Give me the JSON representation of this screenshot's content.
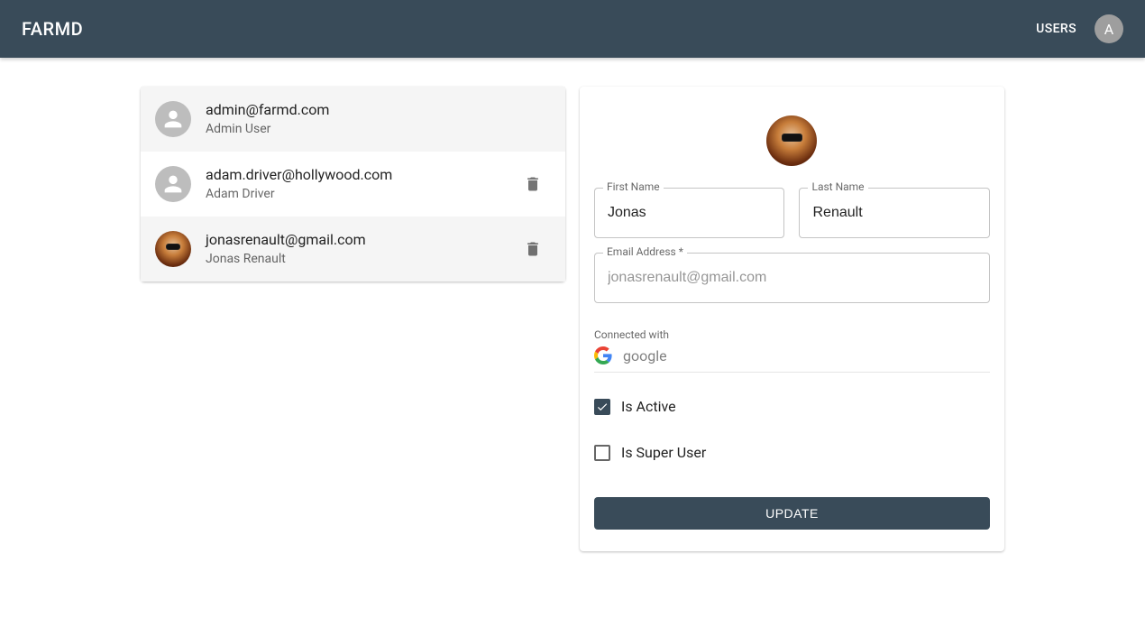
{
  "appbar": {
    "title": "FARMD",
    "nav_users": "USERS",
    "avatar_initial": "A"
  },
  "user_list": [
    {
      "email": "admin@farmd.com",
      "name": "Admin User",
      "has_photo": false,
      "deletable": false
    },
    {
      "email": "adam.driver@hollywood.com",
      "name": "Adam Driver",
      "has_photo": false,
      "deletable": true
    },
    {
      "email": "jonasrenault@gmail.com",
      "name": "Jonas Renault",
      "has_photo": true,
      "deletable": true
    }
  ],
  "detail": {
    "first_name_label": "First Name",
    "first_name_value": "Jonas",
    "last_name_label": "Last Name",
    "last_name_value": "Renault",
    "email_label": "Email Address *",
    "email_placeholder": "jonasrenault@gmail.com",
    "email_value": "",
    "connected_with_label": "Connected with",
    "connected_provider": "google",
    "is_active_label": "Is Active",
    "is_active_checked": true,
    "is_super_user_label": "Is Super User",
    "is_super_user_checked": false,
    "update_button": "UPDATE"
  }
}
